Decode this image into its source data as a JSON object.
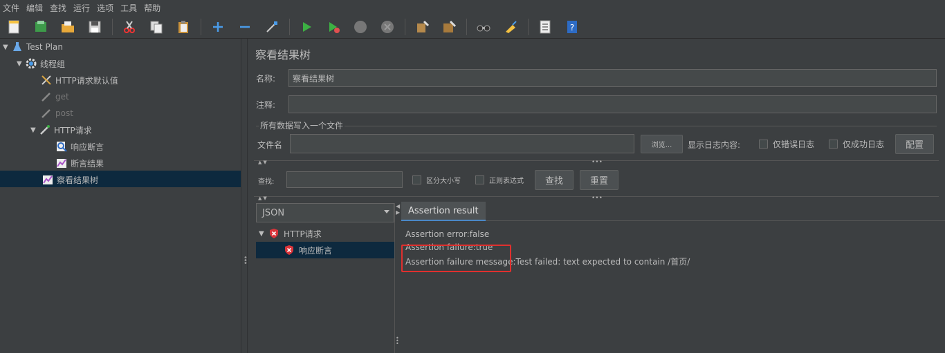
{
  "menu": [
    "文件",
    "编辑",
    "查找",
    "运行",
    "选项",
    "工具",
    "帮助"
  ],
  "toolbar": {
    "icons": [
      "new-icon",
      "templates-icon",
      "open-icon",
      "save-icon",
      "cut-icon",
      "copy-icon",
      "paste-icon",
      "expand-icon",
      "collapse-icon",
      "toggle-icon",
      "start-icon",
      "start-no-pause-icon",
      "stop-icon",
      "shutdown-icon",
      "clear-icon",
      "clear-all-icon",
      "search-icon",
      "reset-search-icon",
      "function-helper-icon",
      "help-icon"
    ]
  },
  "tree": {
    "items": [
      {
        "label": "Test Plan",
        "indent": 0,
        "toggle": "▼",
        "icon": "test-plan-icon",
        "disabled": false
      },
      {
        "label": "线程组",
        "indent": 1,
        "toggle": "▼",
        "icon": "gear-icon",
        "disabled": false
      },
      {
        "label": "HTTP请求默认值",
        "indent": 2,
        "toggle": "",
        "icon": "wrench-icon",
        "disabled": false
      },
      {
        "label": "get",
        "indent": 2,
        "toggle": "",
        "icon": "pipette-icon",
        "disabled": true
      },
      {
        "label": "post",
        "indent": 2,
        "toggle": "",
        "icon": "pipette-icon",
        "disabled": true
      },
      {
        "label": "HTTP请求",
        "indent": 2,
        "toggle": "▼",
        "icon": "pipette-icon",
        "disabled": false
      },
      {
        "label": "响应断言",
        "indent": 3,
        "toggle": "",
        "icon": "magnifier-icon",
        "disabled": false
      },
      {
        "label": "断言结果",
        "indent": 3,
        "toggle": "",
        "icon": "chart-icon",
        "disabled": false
      },
      {
        "label": "察看结果树",
        "indent": 2,
        "toggle": "",
        "icon": "chart-icon",
        "disabled": false
      }
    ],
    "selected_index": 8
  },
  "panel": {
    "title": "察看结果树",
    "name_label": "名称:",
    "name_value": "察看结果树",
    "comment_label": "注释:",
    "comment_value": "",
    "file_group_title": "所有数据写入一个文件",
    "filename_label": "文件名",
    "filename_value": "",
    "browse_label": "浏览...",
    "log_label": "显示日志内容:",
    "errors_only_label": "仅错误日志",
    "success_only_label": "仅成功日志",
    "configure_label": "配置"
  },
  "search": {
    "label": "查找:",
    "value": "",
    "case_label": "区分大小写",
    "regex_label": "正则表达式",
    "find_button": "查找",
    "reset_button": "重置"
  },
  "renderer": {
    "selected": "JSON"
  },
  "result_tree": [
    {
      "label": "HTTP请求",
      "toggle": "▼",
      "icon": "error-shield-icon",
      "selected": false
    },
    {
      "label": "响应断言",
      "toggle": "",
      "icon": "error-shield-icon",
      "selected": true
    }
  ],
  "result_tab": "Assertion result",
  "assertion_lines": [
    "Assertion error:false",
    "Assertion failure:true",
    "Assertion failure message:Test failed: text expected to contain /首页/"
  ],
  "colors": {
    "background": "#3c3f41",
    "selection": "#0d293e",
    "highlight_box": "#e0302e",
    "run_green": "#4caf50"
  }
}
